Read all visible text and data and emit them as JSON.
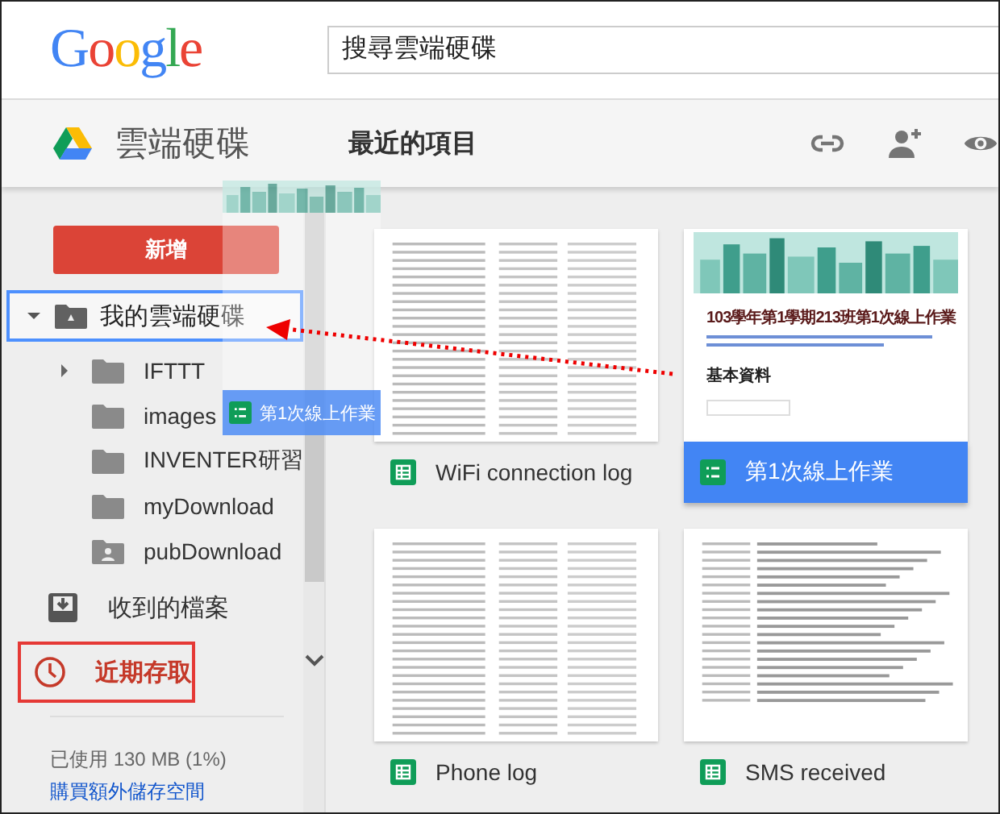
{
  "header": {
    "logo": "Google",
    "search": {
      "placeholder": "搜尋雲端硬碟"
    }
  },
  "toolbar": {
    "app_title": "雲端硬碟",
    "page_title": "最近的項目"
  },
  "sidebar": {
    "new_button": "新增",
    "tree": {
      "label": "我的雲端硬碟",
      "expanded": true,
      "selected": true,
      "children": [
        {
          "label": "IFTTT",
          "kind": "folder",
          "collapsible": true
        },
        {
          "label": "images",
          "kind": "folder",
          "collapsible": false
        },
        {
          "label": "INVENTER研習",
          "kind": "folder",
          "collapsible": false
        },
        {
          "label": "myDownload",
          "kind": "folder",
          "collapsible": false
        },
        {
          "label": "pubDownload",
          "kind": "shared",
          "collapsible": false
        }
      ]
    },
    "nav": [
      {
        "label": "收到的檔案",
        "kind": "inbox",
        "selected": false
      },
      {
        "label": "近期存取",
        "kind": "recent",
        "selected": true
      }
    ],
    "usage": "已使用 130 MB (1%)",
    "buy_link": "購買額外儲存空間"
  },
  "files": [
    {
      "name": "WiFi connection log",
      "kind": "sheet",
      "preview": {
        "kind": "grid"
      },
      "selected": false
    },
    {
      "name": "第1次線上作業",
      "kind": "form",
      "preview": {
        "kind": "form"
      },
      "selected": true,
      "form_title": "103學年第1學期213班第1次線上作業",
      "form_section": "基本資料"
    },
    {
      "name": "Phone log",
      "kind": "sheet",
      "preview": {
        "kind": "grid"
      },
      "selected": false
    },
    {
      "name": "SMS received",
      "kind": "sheet",
      "preview": {
        "kind": "text"
      },
      "selected": false
    }
  ],
  "drag": {
    "label": "第1次線上作業"
  }
}
